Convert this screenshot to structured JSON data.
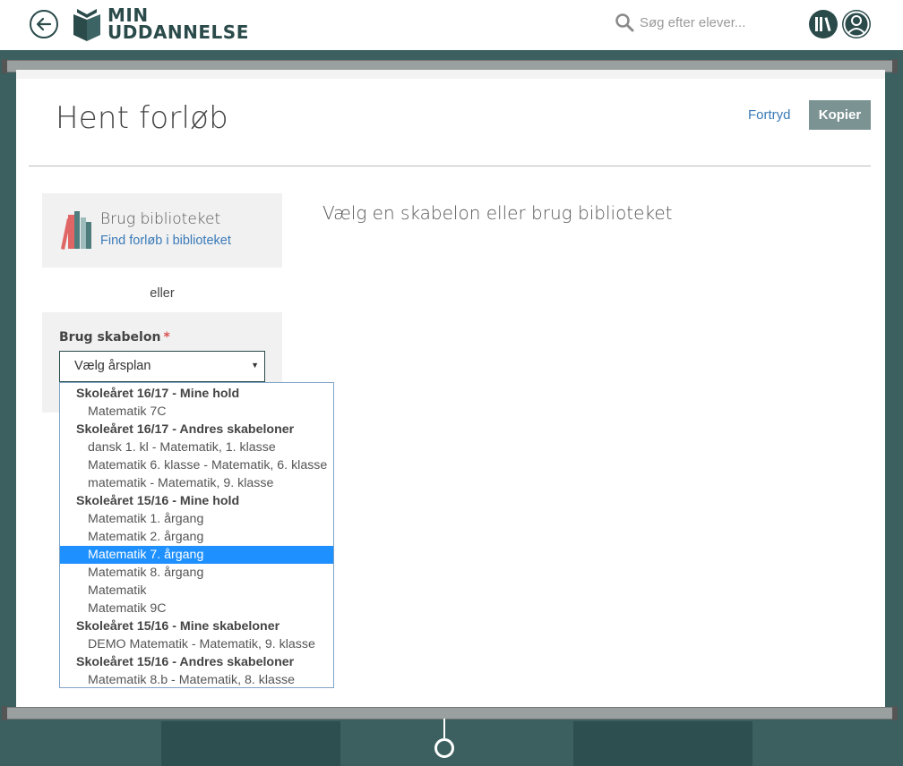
{
  "header": {
    "logo_line1": "MIN",
    "logo_line2": "UDDANNELSE",
    "search_placeholder": "Søg efter elever..."
  },
  "page": {
    "title": "Hent forløb",
    "cancel_label": "Fortryd",
    "copy_label": "Kopier",
    "heading": "Vælg en skabelon eller brug biblioteket"
  },
  "library": {
    "title": "Brug biblioteket",
    "link": "Find forløb i biblioteket"
  },
  "or_text": "eller",
  "template": {
    "label": "Brug skabelon",
    "required_mark": "*",
    "selected": "Vælg årsplan"
  },
  "dropdown": {
    "groups": [
      {
        "label": "Skoleåret 16/17 - Mine hold",
        "options": [
          "Matematik 7C"
        ]
      },
      {
        "label": "Skoleåret 16/17 - Andres skabeloner",
        "options": [
          "dansk 1. kl - Matematik, 1. klasse",
          "Matematik 6. klasse - Matematik, 6. klasse",
          "matematik - Matematik, 9. klasse"
        ]
      },
      {
        "label": "Skoleåret 15/16 - Mine hold",
        "options": [
          "Matematik 1. årgang",
          "Matematik 2. årgang",
          "Matematik 7. årgang",
          "Matematik 8. årgang",
          "Matematik",
          "Matematik 9C"
        ]
      },
      {
        "label": "Skoleåret 15/16 - Mine skabeloner",
        "options": [
          "DEMO Matematik - Matematik, 9. klasse"
        ]
      },
      {
        "label": "Skoleåret 15/16 - Andres skabeloner",
        "options": [
          "Matematik 8.b - Matematik, 8. klasse"
        ]
      }
    ],
    "highlighted": "Matematik 7. årgang"
  },
  "colors": {
    "brand": "#2b4a4a",
    "background": "#3c5f5f",
    "link": "#3a7ab8",
    "button": "#7c9393",
    "highlight": "#1e90ff"
  },
  "icons": {
    "back": "arrow-left-icon",
    "logo": "open-book-logo-icon",
    "search": "search-icon",
    "library": "books-icon",
    "user": "user-icon"
  }
}
